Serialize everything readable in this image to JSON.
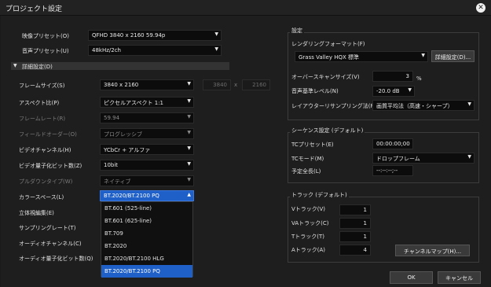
{
  "window": {
    "title": "プロジェクト設定",
    "close_icon": "close-icon"
  },
  "left": {
    "video_preset": {
      "label": "映像プリセット(O)",
      "value": "QFHD 3840 x 2160 59.94p"
    },
    "audio_preset": {
      "label": "音声プリセット(U)",
      "value": "48kHz/2ch"
    },
    "details_toggle": "詳細設定(D)",
    "frame_size": {
      "label": "フレームサイズ(S)",
      "value": "3840 x 2160",
      "width": "3840",
      "x": "x",
      "height": "2160"
    },
    "aspect": {
      "label": "アスペクト比(P)",
      "value": "ピクセルアスペクト 1:1"
    },
    "frame_rate": {
      "label": "フレームレート(R)",
      "value": "59.94"
    },
    "field_order": {
      "label": "フィールドオーダー(O)",
      "value": "プログレッシブ"
    },
    "video_channel": {
      "label": "ビデオチャンネル(H)",
      "value": "YCbCr + アルファ"
    },
    "video_bit": {
      "label": "ビデオ量子化ビット数(Z)",
      "value": "10bit"
    },
    "pulldown": {
      "label": "プルダウンタイプ(W)",
      "value": "ネイティブ"
    },
    "color_space": {
      "label": "カラースペース(L)",
      "value": "BT.2020/BT.2100 PQ",
      "options": [
        "BT.601 (525-line)",
        "BT.601 (625-line)",
        "BT.709",
        "BT.2020",
        "BT.2020/BT.2100 HLG",
        "BT.2020/BT.2100 PQ"
      ]
    },
    "stereo": {
      "label": "立体視編集(E)"
    },
    "sampling": {
      "label": "サンプリングレート(T)"
    },
    "audio_channel": {
      "label": "オーディオチャンネル(C)"
    },
    "audio_bit": {
      "label": "オーディオ量子化ビット数(Q)"
    }
  },
  "settings": {
    "title": "設定",
    "render_format_label": "レンダリングフォーマット(F)",
    "render_format_value": "Grass Valley HQX 標準",
    "details_button": "詳細設定(D)...",
    "overscan_label": "オーバースキャンサイズ(V)",
    "overscan_value": "3",
    "overscan_unit": "%",
    "audio_ref_label": "音声基準レベル(N)",
    "audio_ref_value": "-20.0 dB",
    "resample_label": "レイアウターリサンプリング法(R)",
    "resample_value": "画質平均法（高速・シャープ）"
  },
  "sequence": {
    "title": "シーケンス設定 (デフォルト)",
    "tc_preset_label": "TCプリセット(E)",
    "tc_preset_value": "00:00:00;00",
    "tc_mode_label": "TCモード(M)",
    "tc_mode_value": "ドロップフレーム",
    "duration_label": "予定全長(L)",
    "duration_value": "--:--:--;--"
  },
  "tracks": {
    "title": "トラック (デフォルト)",
    "v_label": "Vトラック(V)",
    "v_value": "1",
    "va_label": "VAトラック(C)",
    "va_value": "1",
    "t_label": "Tトラック(T)",
    "t_value": "1",
    "a_label": "Aトラック(A)",
    "a_value": "4",
    "channel_map_button": "チャンネルマップ(H)..."
  },
  "footer": {
    "ok": "OK",
    "cancel": "キャンセル"
  }
}
